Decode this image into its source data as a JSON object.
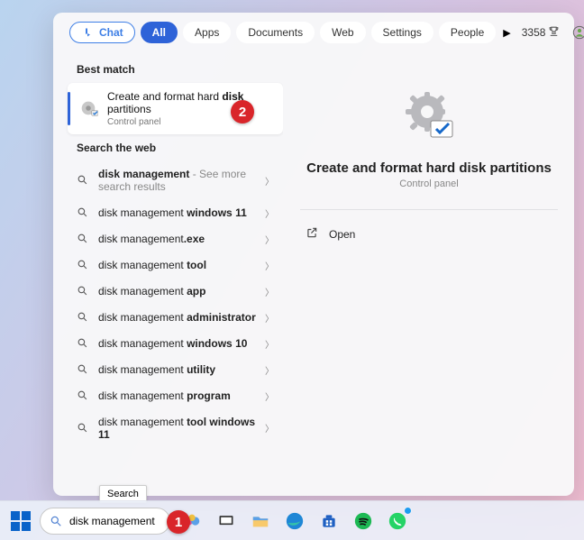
{
  "tabs": {
    "chat": "Chat",
    "all": "All",
    "apps": "Apps",
    "documents": "Documents",
    "web": "Web",
    "settings": "Settings",
    "people": "People"
  },
  "rewards_score": "3358",
  "sections": {
    "best_match": "Best match",
    "search_web": "Search the web"
  },
  "best_match": {
    "title_pre": "Create and format hard ",
    "title_bold": "disk",
    "title_post": " partitions",
    "subtitle": "Control panel"
  },
  "web_results": [
    {
      "pre": "",
      "bold": "disk management",
      "post": "",
      "hint": " - See more search results"
    },
    {
      "pre": "disk management ",
      "bold": "windows 11",
      "post": ""
    },
    {
      "pre": "disk management",
      "bold": ".exe",
      "post": ""
    },
    {
      "pre": "disk management ",
      "bold": "tool",
      "post": ""
    },
    {
      "pre": "disk management ",
      "bold": "app",
      "post": ""
    },
    {
      "pre": "disk management ",
      "bold": "administrator",
      "post": ""
    },
    {
      "pre": "disk management ",
      "bold": "windows 10",
      "post": ""
    },
    {
      "pre": "disk management ",
      "bold": "utility",
      "post": ""
    },
    {
      "pre": "disk management ",
      "bold": "program",
      "post": ""
    },
    {
      "pre": "disk management ",
      "bold": "tool windows 11",
      "post": ""
    }
  ],
  "preview": {
    "title": "Create and format hard disk partitions",
    "subtitle": "Control panel",
    "open_label": "Open"
  },
  "tooltip": "Search",
  "search_value": "disk management",
  "annotations": {
    "one": "1",
    "two": "2"
  }
}
